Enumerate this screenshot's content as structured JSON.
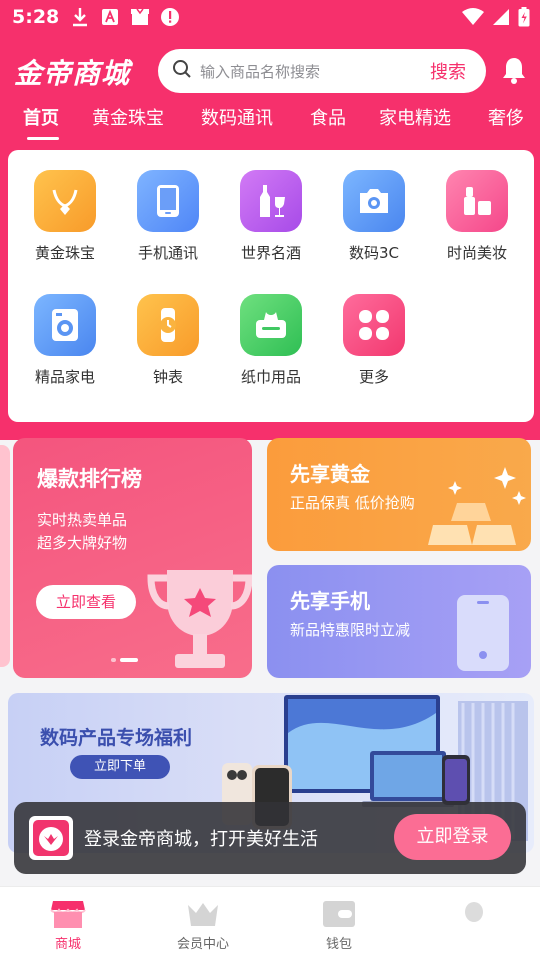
{
  "status_bar": {
    "time": "5:28"
  },
  "header": {
    "logo_text": "金帝商城",
    "search_placeholder": "输入商品名称搜索",
    "search_button": "搜索"
  },
  "tabs": [
    "首页",
    "黄金珠宝",
    "数码通讯",
    "食品",
    "家电精选",
    "奢侈"
  ],
  "categories": [
    {
      "label": "黄金珠宝",
      "icon": "necklace-icon"
    },
    {
      "label": "手机通讯",
      "icon": "phone-icon"
    },
    {
      "label": "世界名酒",
      "icon": "wine-icon"
    },
    {
      "label": "数码3C",
      "icon": "camera-icon"
    },
    {
      "label": "时尚美妆",
      "icon": "cosmetics-icon"
    },
    {
      "label": "精品家电",
      "icon": "washer-icon"
    },
    {
      "label": "钟表",
      "icon": "watch-icon"
    },
    {
      "label": "纸巾用品",
      "icon": "tissue-icon"
    },
    {
      "label": "更多",
      "icon": "more-icon"
    }
  ],
  "ranking": {
    "title": "爆款排行榜",
    "line1": "实时热卖单品",
    "line2": "超多大牌好物",
    "button": "立即查看"
  },
  "gold_promo": {
    "title": "先享黄金",
    "subtitle": "正品保真 低价抢购"
  },
  "phone_promo": {
    "title": "先享手机",
    "subtitle": "新品特惠限时立减"
  },
  "banner": {
    "title": "数码产品专场福利",
    "button": "立即下单"
  },
  "login_toast": {
    "message": "登录金帝商城，打开美好生活",
    "button": "立即登录"
  },
  "bottom_nav": [
    {
      "label": "商城",
      "icon": "shop-icon",
      "active": true
    },
    {
      "label": "会员中心",
      "icon": "crown-icon",
      "active": false
    },
    {
      "label": "钱包",
      "icon": "wallet-icon",
      "active": false
    },
    {
      "label": "",
      "icon": "profile-icon",
      "active": false
    }
  ],
  "colors": {
    "brand": "#f6306c",
    "gold": "#fb9c3c",
    "phone": "#8b90f0",
    "banner_text": "#3b4fae"
  }
}
